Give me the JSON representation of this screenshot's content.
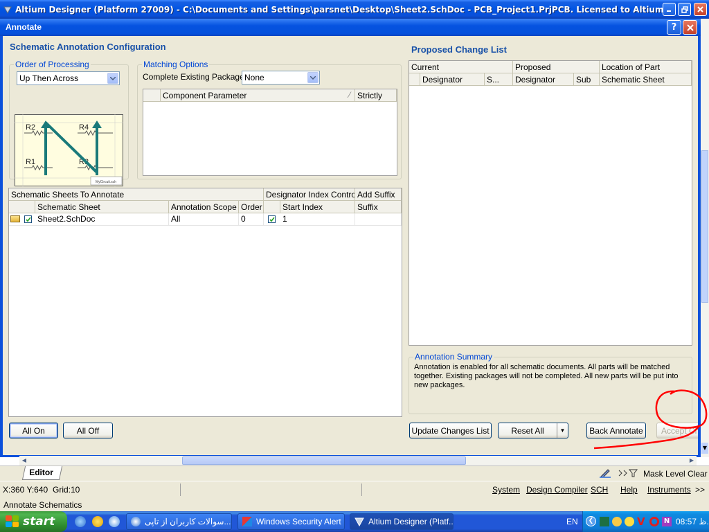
{
  "app": {
    "title": "Altium Designer (Platform 27009) - C:\\Documents and Settings\\parsnet\\Desktop\\Sheet2.SchDoc - PCB_Project1.PrjPCB. Licensed to Altium Designer..."
  },
  "dialog": {
    "title": "Annotate",
    "config_title": "Schematic Annotation Configuration",
    "order": {
      "legend": "Order of Processing",
      "selected": "Up Then Across",
      "diagram_labels": [
        "R2",
        "R4",
        "R1",
        "R3"
      ],
      "diagram_caption": "MyCircuit.sch"
    },
    "matching": {
      "legend": "Matching Options",
      "complete_label": "Complete Existing Packages",
      "complete_value": "None",
      "columns": [
        "Component Parameter",
        "Strictly"
      ]
    },
    "sheets": {
      "group_headers": [
        "Schematic Sheets To Annotate",
        "Designator Index Control",
        "Add Suffix"
      ],
      "columns": [
        "Schematic Sheet",
        "Annotation Scope",
        "Order",
        "Start Index",
        "Suffix"
      ],
      "rows": [
        {
          "checked": true,
          "sheet": "Sheet2.SchDoc",
          "scope": "All",
          "order": "0",
          "index_checked": true,
          "start_index": "1",
          "suffix": ""
        }
      ]
    },
    "proposed": {
      "title": "Proposed Change List",
      "group_headers": [
        "Current",
        "Proposed",
        "Location of Part"
      ],
      "columns": [
        "Designator",
        "S...",
        "Designator",
        "Sub",
        "Schematic Sheet"
      ]
    },
    "summary": {
      "legend": "Annotation Summary",
      "text": "Annotation is enabled for all schematic documents. All parts will be matched together. Existing packages will not be completed. All new parts will be put into new packages."
    },
    "buttons": {
      "all_on": "All On",
      "all_off": "All Off",
      "update": "Update Changes List",
      "reset": "Reset All",
      "back_annotate": "Back Annotate",
      "accept": "Accept Cha"
    }
  },
  "editor": {
    "tab": "Editor",
    "right_tools": [
      "Mask Level",
      "Clear"
    ]
  },
  "status": {
    "coords": "X:360 Y:640",
    "grid": "Grid:10",
    "panels": [
      "System",
      "Design Compiler",
      "SCH",
      "Help",
      "Instruments",
      ">>"
    ],
    "message": "Annotate Schematics"
  },
  "taskbar": {
    "start": "start",
    "items": [
      "سوالات کاربران از تاپی...",
      "Windows Security Alert",
      "Altium Designer (Platf..."
    ],
    "lang": "EN",
    "clock": "08:57 ب.ظ"
  },
  "colors": {
    "xp_blue": "#0054e3",
    "dialog_face": "#ece9d8",
    "section_blue": "#1a52a8",
    "highlight_circle": "#ff0000",
    "diagram_arrow": "#1a7a7a"
  }
}
